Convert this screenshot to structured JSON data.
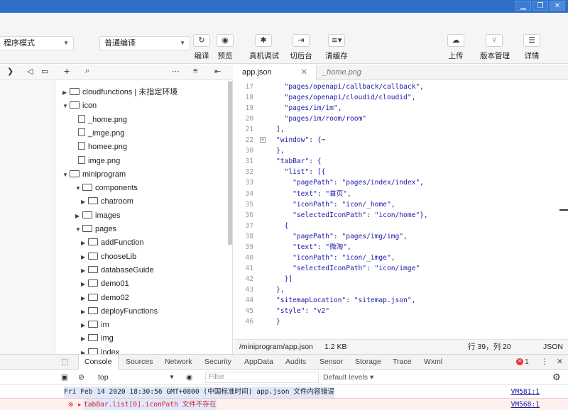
{
  "window": {
    "min": "▁",
    "max": "❐",
    "close": "✕"
  },
  "toolbar": {
    "mode_select": "程序模式",
    "compile_select": "普通编译",
    "buttons": [
      {
        "id": "compile",
        "label": "编译",
        "icon": "↻"
      },
      {
        "id": "preview",
        "label": "预览",
        "icon": "◉"
      },
      {
        "id": "remote_debug",
        "label": "真机调试",
        "icon": "✱"
      },
      {
        "id": "background",
        "label": "切后台",
        "icon": "⇥"
      },
      {
        "id": "clear_cache",
        "label": "清缓存",
        "icon": "≋▾"
      },
      {
        "id": "upload",
        "label": "上传",
        "icon": "☁"
      },
      {
        "id": "version",
        "label": "版本管理",
        "icon": "⑂"
      },
      {
        "id": "details",
        "label": "详情",
        "icon": "☰"
      }
    ]
  },
  "sidebar": {
    "tree": [
      {
        "label": "cloudfunctions | 未指定环境",
        "type": "folder",
        "open": false,
        "depth": 0
      },
      {
        "label": "icon",
        "type": "folder",
        "open": true,
        "depth": 0
      },
      {
        "label": "_home.png",
        "type": "image",
        "depth": 1
      },
      {
        "label": "_imge.png",
        "type": "image",
        "depth": 1
      },
      {
        "label": "homee.png",
        "type": "image",
        "depth": 1
      },
      {
        "label": "imge.png",
        "type": "image",
        "depth": 1
      },
      {
        "label": "miniprogram",
        "type": "folder",
        "open": true,
        "depth": 0
      },
      {
        "label": "components",
        "type": "folder",
        "open": true,
        "depth": 1
      },
      {
        "label": "chatroom",
        "type": "folder",
        "open": false,
        "depth": 2
      },
      {
        "label": "images",
        "type": "folder",
        "open": false,
        "depth": 1
      },
      {
        "label": "pages",
        "type": "folder",
        "open": true,
        "depth": 1
      },
      {
        "label": "addFunction",
        "type": "folder",
        "open": false,
        "depth": 2
      },
      {
        "label": "chooseLib",
        "type": "folder",
        "open": false,
        "depth": 2
      },
      {
        "label": "databaseGuide",
        "type": "folder",
        "open": false,
        "depth": 2
      },
      {
        "label": "demo01",
        "type": "folder",
        "open": false,
        "depth": 2
      },
      {
        "label": "demo02",
        "type": "folder",
        "open": false,
        "depth": 2
      },
      {
        "label": "deployFunctions",
        "type": "folder",
        "open": false,
        "depth": 2
      },
      {
        "label": "im",
        "type": "folder",
        "open": false,
        "depth": 2
      },
      {
        "label": "img",
        "type": "folder",
        "open": false,
        "depth": 2
      },
      {
        "label": "index",
        "type": "folder",
        "open": false,
        "depth": 2
      }
    ]
  },
  "editor": {
    "tabs": [
      {
        "label": "app.json",
        "active": true,
        "close": "✕"
      },
      {
        "label": "_home.png",
        "active": false
      }
    ],
    "lines": [
      {
        "n": "17",
        "t": "  \"pages/openapi/callback/callback\","
      },
      {
        "n": "18",
        "t": "  \"pages/openapi/cloudid/cloudid\","
      },
      {
        "n": "19",
        "t": "  \"pages/im/im\","
      },
      {
        "n": "20",
        "t": "  \"pages/im/room/room\""
      },
      {
        "n": "21",
        "t": "],"
      },
      {
        "n": "22",
        "t": "\"window\": {⋯",
        "fold": "+"
      },
      {
        "n": "30",
        "t": "},"
      },
      {
        "n": "31",
        "t": "\"tabBar\": {"
      },
      {
        "n": "32",
        "t": "  \"list\": [{"
      },
      {
        "n": "33",
        "t": "    \"pagePath\": \"pages/index/index\","
      },
      {
        "n": "34",
        "t": "    \"text\": \"首页\","
      },
      {
        "n": "35",
        "t": "    \"iconPath\": \"icon/_home\","
      },
      {
        "n": "36",
        "t": "    \"selectedIconPath\": \"icon/home\"},"
      },
      {
        "n": "37",
        "t": "  {"
      },
      {
        "n": "38",
        "t": "    \"pagePath\": \"pages/img/img\","
      },
      {
        "n": "39",
        "t": "    \"text\": \"微淘\","
      },
      {
        "n": "40",
        "t": "    \"iconPath\": \"icon/_imge\","
      },
      {
        "n": "41",
        "t": "    \"selectedIconPath\": \"icon/imge\""
      },
      {
        "n": "42",
        "t": "  }]"
      },
      {
        "n": "43",
        "t": "},"
      },
      {
        "n": "44",
        "t": "\"sitemapLocation\": \"sitemap.json\","
      },
      {
        "n": "45",
        "t": "\"style\": \"v2\""
      },
      {
        "n": "46",
        "t": "}"
      }
    ]
  },
  "status": {
    "path": "/miniprogram/app.json",
    "size": "1.2 KB",
    "position": "行 39，列 20",
    "lang": "JSON"
  },
  "devtools": {
    "tabs": [
      "Console",
      "Sources",
      "Network",
      "Security",
      "AppData",
      "Audits",
      "Sensor",
      "Storage",
      "Trace",
      "Wxml"
    ],
    "error_count": "1",
    "context": "top",
    "filter_placeholder": "Filter",
    "levels": "Default levels ▾",
    "log1": "Fri Feb 14 2020 18:30:56 GMT+0800 (中国标准时间)  app.json 文件内容错误",
    "log1_src": "VM581:1",
    "log2": "tabBar.list[0].iconPath 文件不存在",
    "log2_src": "VM568:1"
  },
  "colors": {
    "titlebar": "#2f6fc7",
    "error": "#e0201a",
    "selection": "#dfe9fb"
  }
}
